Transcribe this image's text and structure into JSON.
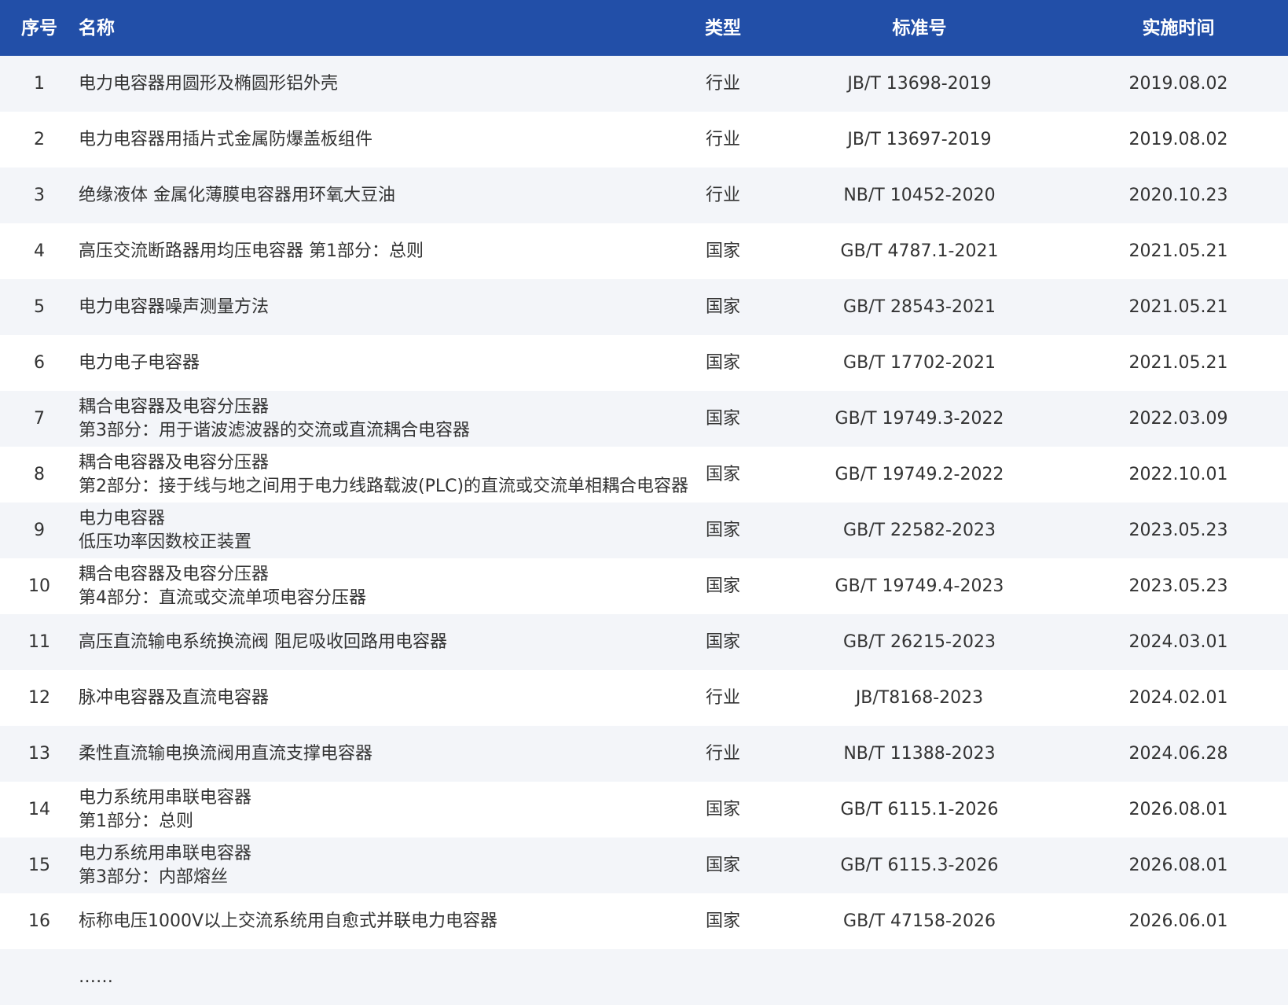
{
  "header": {
    "no": "序号",
    "name": "名称",
    "type": "类型",
    "standard": "标准号",
    "date": "实施时间"
  },
  "rows": [
    {
      "no": "1",
      "name": [
        "电力电容器用圆形及椭圆形铝外壳"
      ],
      "type": "行业",
      "standard": "JB/T 13698-2019",
      "date": "2019.08.02"
    },
    {
      "no": "2",
      "name": [
        "电力电容器用插片式金属防爆盖板组件"
      ],
      "type": "行业",
      "standard": "JB/T 13697-2019",
      "date": "2019.08.02"
    },
    {
      "no": "3",
      "name": [
        "绝缘液体 金属化薄膜电容器用环氧大豆油"
      ],
      "type": "行业",
      "standard": "NB/T 10452-2020",
      "date": "2020.10.23"
    },
    {
      "no": "4",
      "name": [
        "高压交流断路器用均压电容器 第1部分：总则"
      ],
      "type": "国家",
      "standard": "GB/T 4787.1-2021",
      "date": "2021.05.21"
    },
    {
      "no": "5",
      "name": [
        "电力电容器噪声测量方法"
      ],
      "type": "国家",
      "standard": "GB/T 28543-2021",
      "date": "2021.05.21"
    },
    {
      "no": "6",
      "name": [
        "电力电子电容器"
      ],
      "type": "国家",
      "standard": "GB/T 17702-2021",
      "date": "2021.05.21"
    },
    {
      "no": "7",
      "name": [
        "耦合电容器及电容分压器",
        "第3部分：用于谐波滤波器的交流或直流耦合电容器"
      ],
      "type": "国家",
      "standard": "GB/T 19749.3-2022",
      "date": "2022.03.09"
    },
    {
      "no": "8",
      "name": [
        "耦合电容器及电容分压器",
        "第2部分：接于线与地之间用于电力线路载波(PLC)的直流或交流单相耦合电容器"
      ],
      "type": "国家",
      "standard": "GB/T 19749.2-2022",
      "date": "2022.10.01"
    },
    {
      "no": "9",
      "name": [
        "电力电容器",
        "低压功率因数校正装置"
      ],
      "type": "国家",
      "standard": "GB/T 22582-2023",
      "date": "2023.05.23"
    },
    {
      "no": "10",
      "name": [
        "耦合电容器及电容分压器",
        "第4部分：直流或交流单项电容分压器"
      ],
      "type": "国家",
      "standard": "GB/T 19749.4-2023",
      "date": "2023.05.23"
    },
    {
      "no": "11",
      "name": [
        "高压直流输电系统换流阀 阻尼吸收回路用电容器"
      ],
      "type": "国家",
      "standard": "GB/T 26215-2023",
      "date": "2024.03.01"
    },
    {
      "no": "12",
      "name": [
        "脉冲电容器及直流电容器"
      ],
      "type": "行业",
      "standard": "JB/T8168-2023",
      "date": "2024.02.01"
    },
    {
      "no": "13",
      "name": [
        "柔性直流输电换流阀用直流支撑电容器"
      ],
      "type": "行业",
      "standard": "NB/T 11388-2023",
      "date": "2024.06.28"
    },
    {
      "no": "14",
      "name": [
        "电力系统用串联电容器",
        "第1部分：总则"
      ],
      "type": "国家",
      "standard": "GB/T 6115.1-2026",
      "date": "2026.08.01"
    },
    {
      "no": "15",
      "name": [
        "电力系统用串联电容器",
        "第3部分：内部熔丝"
      ],
      "type": "国家",
      "standard": "GB/T 6115.3-2026",
      "date": "2026.08.01"
    },
    {
      "no": "16",
      "name": [
        "标称电压1000V以上交流系统用自愈式并联电力电容器"
      ],
      "type": "国家",
      "standard": "GB/T 47158-2026",
      "date": "2026.06.01"
    }
  ],
  "ellipsis": "……",
  "colors": {
    "header_bg": "#224fa8",
    "header_text": "#ffffff",
    "row_alt_bg": "#f3f5f9",
    "row_bg": "#ffffff",
    "text": "#333333"
  }
}
